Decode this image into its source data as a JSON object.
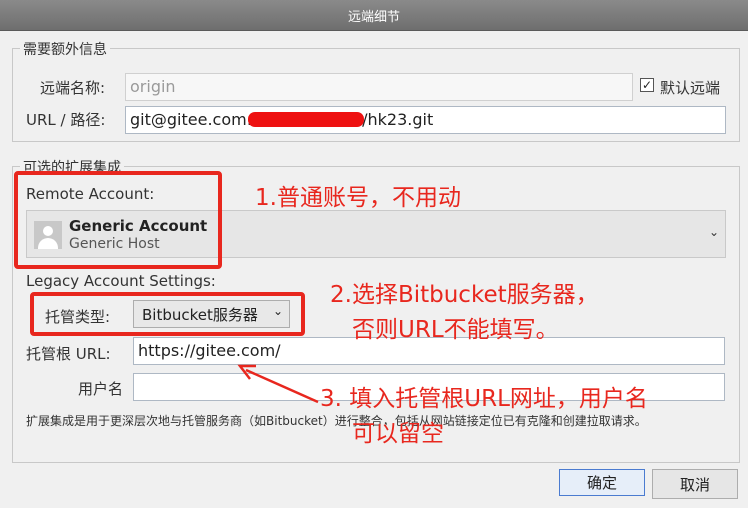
{
  "window": {
    "title": "远端细节"
  },
  "required": {
    "group_title": "需要额外信息",
    "remote_name_label": "远端名称:",
    "remote_name_value": "origin",
    "default_remote_label": "默认远端",
    "default_remote_checked": true,
    "url_label": "URL / 路径:",
    "url_prefix": "git@gitee.com:",
    "url_suffix": "/hk23.git"
  },
  "integration": {
    "group_title": "可选的扩展集成",
    "remote_account_label": "Remote Account:",
    "account_name": "Generic Account",
    "account_host": "Generic Host",
    "legacy_label": "Legacy Account Settings:",
    "hosting_type_label": "托管类型:",
    "hosting_type_value": "Bitbucket服务器",
    "hosting_root_label": "托管根 URL:",
    "hosting_root_value": "https://gitee.com/",
    "username_label": "用户名",
    "username_value": "",
    "description": "扩展集成是用于更深层次地与托管服务商（如Bitbucket）进行整合，包括从网站链接定位已有克隆和创建拉取请求。"
  },
  "buttons": {
    "ok": "确定",
    "cancel": "取消"
  },
  "annotations": {
    "note1": "1.普通账号，不用动",
    "note2_line1": "2.选择Bitbucket服务器，",
    "note2_line2": "否则URL不能填写。",
    "note3_line1": "3. 填入托管根URL网址，用户名",
    "note3_line2": "可以留空"
  },
  "colors": {
    "annotation": "#e8271e",
    "titlebar": "#7a7a7a"
  }
}
